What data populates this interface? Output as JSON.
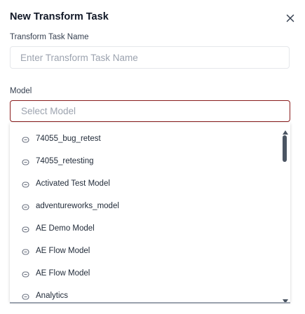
{
  "dialog": {
    "title": "New Transform Task",
    "close_icon": "close-icon"
  },
  "task_name": {
    "label": "Transform Task Name",
    "placeholder": "Enter Transform Task Name",
    "value": ""
  },
  "model": {
    "label": "Model",
    "placeholder": "Select Model",
    "option_icon": "model-icon",
    "options": [
      "74055_bug_retest",
      "74055_retesting",
      "Activated Test Model",
      "adventureworks_model",
      "AE Demo Model",
      "AE Flow Model",
      "AE Flow Model",
      "Analytics"
    ]
  },
  "colors": {
    "select_border": "#8a1c1c",
    "scrollbar": "#4b5563"
  }
}
